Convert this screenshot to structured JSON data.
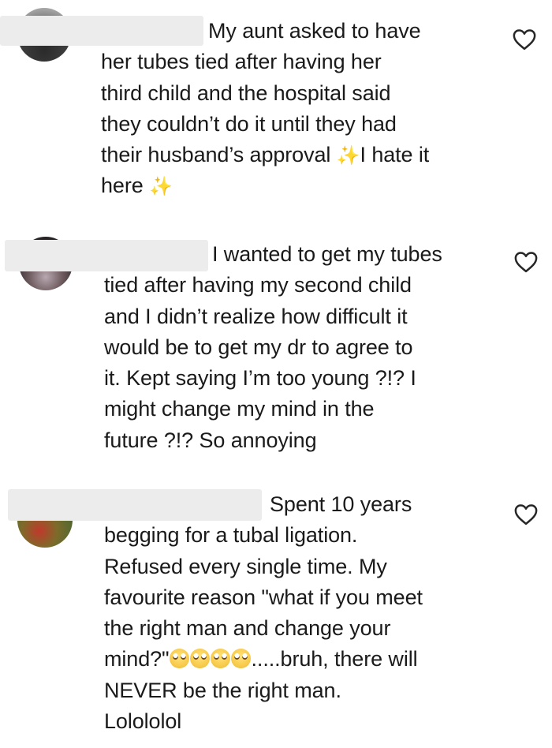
{
  "comments": [
    {
      "lines": [
        "My aunt asked to have",
        "her tubes tied after having her",
        "third child and the hospital said",
        "they couldn’t do it until they had",
        "their husband’s approval",
        "I hate it",
        "here"
      ],
      "sparkle_icon": "sparkles-icon",
      "like_icon": "heart-outline-icon"
    },
    {
      "lines": [
        "I wanted to get my tubes",
        "tied after having my second child",
        "and I didn’t realize how difficult it",
        "would be to get my dr to agree to",
        "it. Kept saying I’m too young ?!? I",
        "might change my mind in the",
        "future ?!? So annoying"
      ],
      "like_icon": "heart-outline-icon"
    },
    {
      "lines": [
        "Spent 10 years",
        "begging for a tubal ligation.",
        "Refused every single time. My",
        "favourite reason \"what if you meet",
        "the right man and change your",
        "mind?\"",
        ".....bruh, there will",
        "NEVER be the right man.",
        "Lolololol"
      ],
      "emoji_icon": "eye-roll-face-icon",
      "like_icon": "heart-outline-icon"
    }
  ],
  "colors": {
    "text": "#1a1a1a",
    "redaction": "#ececec",
    "sparkle": "#f3c94a",
    "background": "#ffffff"
  }
}
